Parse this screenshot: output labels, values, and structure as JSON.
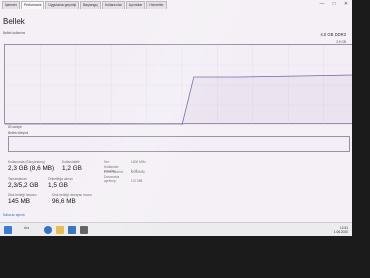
{
  "tabs": [
    "İşlemler",
    "Performans",
    "Uygulama geçmişi",
    "Başlangıç",
    "Kullanıcılar",
    "Ayrıntılar",
    "Hizmetler"
  ],
  "title": "Bellek",
  "usage_label": "Bellek kullanımı",
  "total": "4,0 GB DDR3",
  "scale_max": "3,9 GB",
  "time_label": "60 saniye",
  "composition_label": "Bellek bileşimi",
  "stats": {
    "in_use": {
      "label": "Kullanımda (Sıkıştırılmış)",
      "value": "2,3 GB (8,6 MB)"
    },
    "available": {
      "label": "Kullanılabilir",
      "value": "1,2 GB"
    },
    "committed": {
      "label": "Tamamlanan",
      "value": "2,3/5,2 GB"
    },
    "cached": {
      "label": "Önbelleğe alınan",
      "value": "1,5 GB"
    },
    "paged_pool": {
      "label": "Disk belleği havuzu",
      "value": "145 MB"
    },
    "nonpaged_pool": {
      "label": "Disk belleği olmayan havuz",
      "value": "96,6 MB"
    }
  },
  "details": [
    {
      "key": "Hız:",
      "value": "1600 MHz"
    },
    {
      "key": "Kullanılan yuvalar:",
      "value": "1 / 2"
    },
    {
      "key": "Form faktörü:",
      "value": "SODIMM"
    },
    {
      "key": "Donanıma ayrılmış:",
      "value": "107 MB"
    }
  ],
  "less_details": "Daha az ayrıntı",
  "search_label": "Ara",
  "tray": {
    "time": "12:51",
    "date": "1.06.2020"
  },
  "colors": {
    "chart_line": "#7b61a3",
    "accent": "#8a6fb0"
  },
  "chart_data": {
    "type": "line",
    "x": [
      0,
      10,
      20,
      30,
      32,
      40,
      50,
      59,
      60
    ],
    "values": [
      0,
      0,
      0,
      0,
      2.4,
      2.4,
      2.45,
      2.5,
      2.9
    ],
    "ylim": [
      0,
      4
    ],
    "xlabel": "60 saniye",
    "ylabel": "Bellek kullanımı"
  }
}
